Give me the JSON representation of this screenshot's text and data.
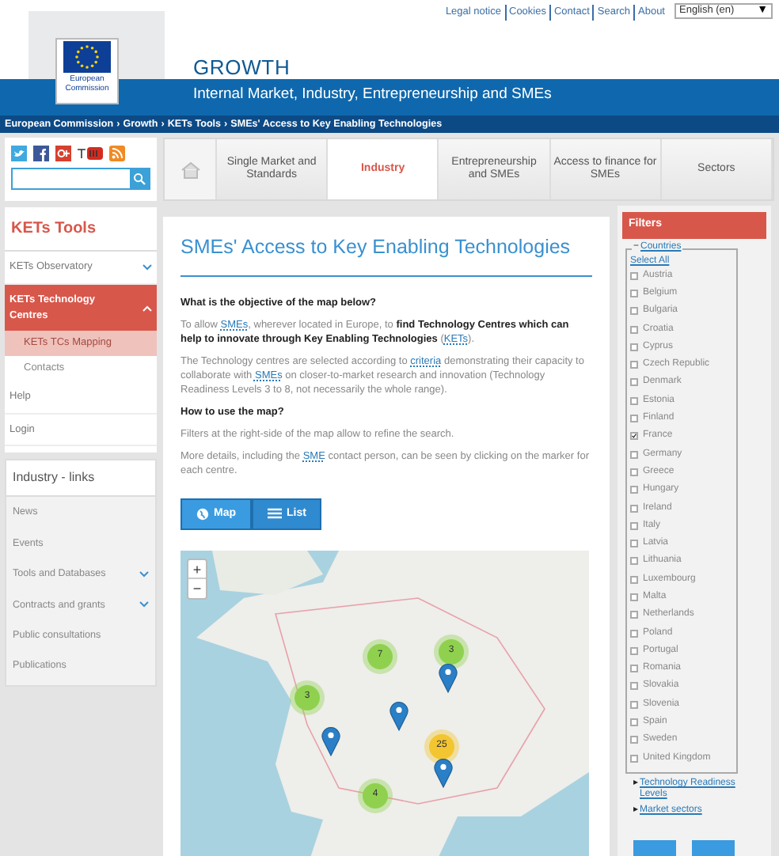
{
  "top_links": [
    "Legal notice",
    "Cookies",
    "Contact",
    "Search",
    "About"
  ],
  "language": {
    "value": "English (en)",
    "arrow": "▼"
  },
  "logo": {
    "caption": "European Commission"
  },
  "site": {
    "title": "GROWTH",
    "subtitle": "Internal Market, Industry, Entrepreneurship and SMEs"
  },
  "breadcrumb": {
    "separator": "›",
    "items": [
      "European Commission",
      "Growth",
      "KETs Tools",
      "SMEs' Access to Key Enabling Technologies"
    ]
  },
  "nav": [
    {
      "label": "Single Market and Standards",
      "selected": false
    },
    {
      "label": "Industry",
      "selected": true
    },
    {
      "label": "Entrepreneurship and SMEs",
      "selected": false
    },
    {
      "label": "Access to finance for SMEs",
      "selected": false
    },
    {
      "label": "Sectors",
      "selected": false
    }
  ],
  "sidebar_tools": {
    "title": "KETs Tools",
    "items": [
      {
        "label": "KETs Observatory",
        "selected": false,
        "expanded": false
      },
      {
        "label": "KETs Technology Centres",
        "selected": true,
        "expanded": true,
        "children": [
          {
            "label": "KETs TCs Mapping",
            "selected": true
          },
          {
            "label": "Contacts",
            "selected": false
          }
        ]
      },
      {
        "label": "Help",
        "selected": false
      },
      {
        "label": "Login",
        "selected": false
      }
    ]
  },
  "sidebar_links": {
    "title": "Industry - links",
    "items": [
      {
        "label": "News"
      },
      {
        "label": "Events"
      },
      {
        "label": "Tools and Databases",
        "expanded": false
      },
      {
        "label": "Contracts and grants",
        "expanded": false
      },
      {
        "label": "Public consultations"
      },
      {
        "label": "Publications"
      }
    ]
  },
  "main": {
    "title": "SMEs' Access to Key Enabling Technologies",
    "blocks": [
      {
        "kind": "heading",
        "segments": [
          {
            "kind": "text",
            "text": "What is the objective of the map below?"
          }
        ]
      },
      {
        "kind": "paragraph",
        "segments": [
          {
            "kind": "text",
            "text": "To allow "
          },
          {
            "kind": "link",
            "text": "SMEs"
          },
          {
            "kind": "text",
            "text": ", wherever located in Europe, to "
          },
          {
            "kind": "bold",
            "text": "find Technology Centres which can help to innovate through Key Enabling Technologies"
          },
          {
            "kind": "text",
            "text": " ("
          },
          {
            "kind": "link",
            "text": "KETs"
          },
          {
            "kind": "text",
            "text": ")."
          }
        ]
      },
      {
        "kind": "paragraph",
        "segments": [
          {
            "kind": "text",
            "text": "The Technology centres are selected according to "
          },
          {
            "kind": "link",
            "text": "criteria"
          },
          {
            "kind": "text",
            "text": " demonstrating their capacity to collaborate with "
          },
          {
            "kind": "link",
            "text": "SMEs"
          },
          {
            "kind": "text",
            "text": " on closer-to-market research and innovation (Technology Readiness Levels 3 to 8, not necessarily the whole range)."
          }
        ]
      },
      {
        "kind": "heading",
        "segments": [
          {
            "kind": "text",
            "text": "How to use the map?"
          }
        ]
      },
      {
        "kind": "paragraph",
        "segments": [
          {
            "kind": "text",
            "text": "Filters at the right-side of the map allow to refine the search."
          }
        ]
      },
      {
        "kind": "paragraph",
        "segments": [
          {
            "kind": "text",
            "text": "More details, including the "
          },
          {
            "kind": "link",
            "text": "SME"
          },
          {
            "kind": "text",
            "text": " contact person, can be seen by clicking on the marker for each centre."
          }
        ]
      }
    ],
    "views": [
      {
        "label": "Map",
        "kind": "map",
        "selected": true
      },
      {
        "label": "List",
        "kind": "list",
        "selected": false
      }
    ],
    "map": {
      "zoom_in": "+",
      "zoom_out": "−",
      "clusters": [
        {
          "count": "7",
          "color": "#8fd14f"
        },
        {
          "count": "3",
          "color": "#8fd14f"
        },
        {
          "count": "3",
          "color": "#8fd14f"
        },
        {
          "count": "25",
          "color": "#f3c530"
        },
        {
          "count": "4",
          "color": "#8fd14f"
        }
      ]
    }
  },
  "filters": {
    "title": "Filters",
    "groups": [
      {
        "label": "Countries",
        "toggle": "−",
        "expanded": true,
        "select_all": "Select All",
        "options": [
          {
            "label": "Austria",
            "checked": false
          },
          {
            "label": "Belgium",
            "checked": false
          },
          {
            "label": "Bulgaria",
            "checked": false
          },
          {
            "label": "Croatia",
            "checked": false
          },
          {
            "label": "Cyprus",
            "checked": false
          },
          {
            "label": "Czech Republic",
            "checked": false
          },
          {
            "label": "Denmark",
            "checked": false
          },
          {
            "label": "Estonia",
            "checked": false
          },
          {
            "label": "Finland",
            "checked": false
          },
          {
            "label": "France",
            "checked": true
          },
          {
            "label": "Germany",
            "checked": false
          },
          {
            "label": "Greece",
            "checked": false
          },
          {
            "label": "Hungary",
            "checked": false
          },
          {
            "label": "Ireland",
            "checked": false
          },
          {
            "label": "Italy",
            "checked": false
          },
          {
            "label": "Latvia",
            "checked": false
          },
          {
            "label": "Lithuania",
            "checked": false
          },
          {
            "label": "Luxembourg",
            "checked": false
          },
          {
            "label": "Malta",
            "checked": false
          },
          {
            "label": "Netherlands",
            "checked": false
          },
          {
            "label": "Poland",
            "checked": false
          },
          {
            "label": "Portugal",
            "checked": false
          },
          {
            "label": "Romania",
            "checked": false
          },
          {
            "label": "Slovakia",
            "checked": false
          },
          {
            "label": "Slovenia",
            "checked": false
          },
          {
            "label": "Spain",
            "checked": false
          },
          {
            "label": "Sweden",
            "checked": false
          },
          {
            "label": "United Kingdom",
            "checked": false
          }
        ]
      },
      {
        "label": "Technology Readiness Levels",
        "toggle": "▸",
        "expanded": false
      },
      {
        "label": "Market sectors",
        "toggle": "▸",
        "expanded": false
      }
    ]
  }
}
